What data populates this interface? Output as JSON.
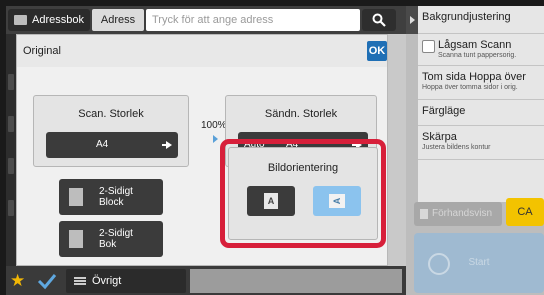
{
  "topbar": {
    "address_book_label": "Adressbok",
    "address_label": "Adress",
    "address_placeholder": "Tryck för att ange adress"
  },
  "right_panel": {
    "items": [
      {
        "title": "Bakgrundjustering",
        "subtitle": ""
      },
      {
        "title": "Lågsam Scann",
        "subtitle": "Scanna tunt pappersorig."
      },
      {
        "title": "Tom sida Hoppa över",
        "subtitle": "Hoppa över tomma sidor i orig."
      },
      {
        "title": "Färgläge",
        "subtitle": ""
      },
      {
        "title": "Skärpa",
        "subtitle": "Justera bildens kontur"
      }
    ],
    "favorites_label": "Förhandsvisn",
    "ca_label": "CA",
    "start_label": "Start"
  },
  "original": {
    "title": "Original",
    "ok_label": "OK",
    "scan_size": {
      "title": "Scan. Storlek",
      "value": "A4"
    },
    "ratio": "100%",
    "send_size": {
      "title": "Sändn. Storlek",
      "mode": "Auto",
      "value": "A4"
    },
    "duplex_block": "2-Sidigt\nBlock",
    "duplex_book": "2-Sidigt\nBok",
    "orientation": {
      "title": "Bildorientering",
      "glyph_a": "A",
      "glyph_b": "A"
    }
  },
  "bottom": {
    "other_label": "Övrigt"
  },
  "colors": {
    "ok": "#1f6fb5",
    "ca": "#f3c300",
    "highlight": "#d71f3a",
    "selected": "#8bc3ee"
  }
}
